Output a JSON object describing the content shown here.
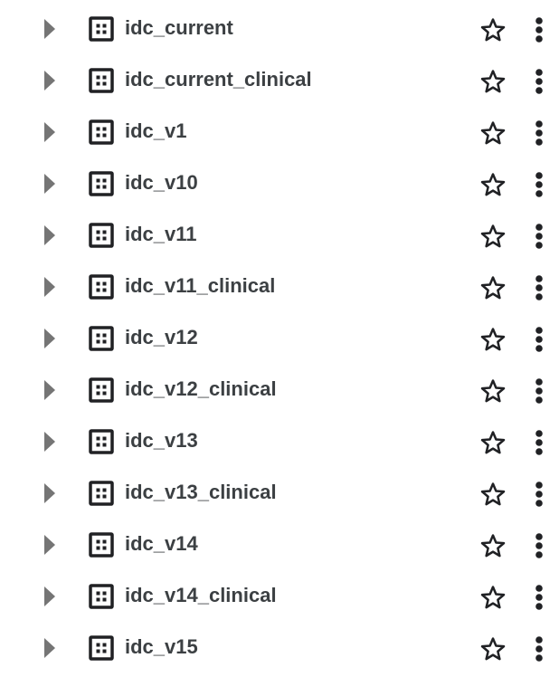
{
  "datasets": [
    {
      "name": "idc_current"
    },
    {
      "name": "idc_current_clinical"
    },
    {
      "name": "idc_v1"
    },
    {
      "name": "idc_v10"
    },
    {
      "name": "idc_v11"
    },
    {
      "name": "idc_v11_clinical"
    },
    {
      "name": "idc_v12"
    },
    {
      "name": "idc_v12_clinical"
    },
    {
      "name": "idc_v13"
    },
    {
      "name": "idc_v13_clinical"
    },
    {
      "name": "idc_v14"
    },
    {
      "name": "idc_v14_clinical"
    },
    {
      "name": "idc_v15"
    }
  ],
  "icons": {
    "expander": "triangle-right-icon",
    "dataset": "dataset-grid-icon",
    "star": "star-outline-icon",
    "menu": "more-vert-icon"
  },
  "colors": {
    "text": "#3c4043",
    "expander": "#757575",
    "icon": "#202124"
  }
}
